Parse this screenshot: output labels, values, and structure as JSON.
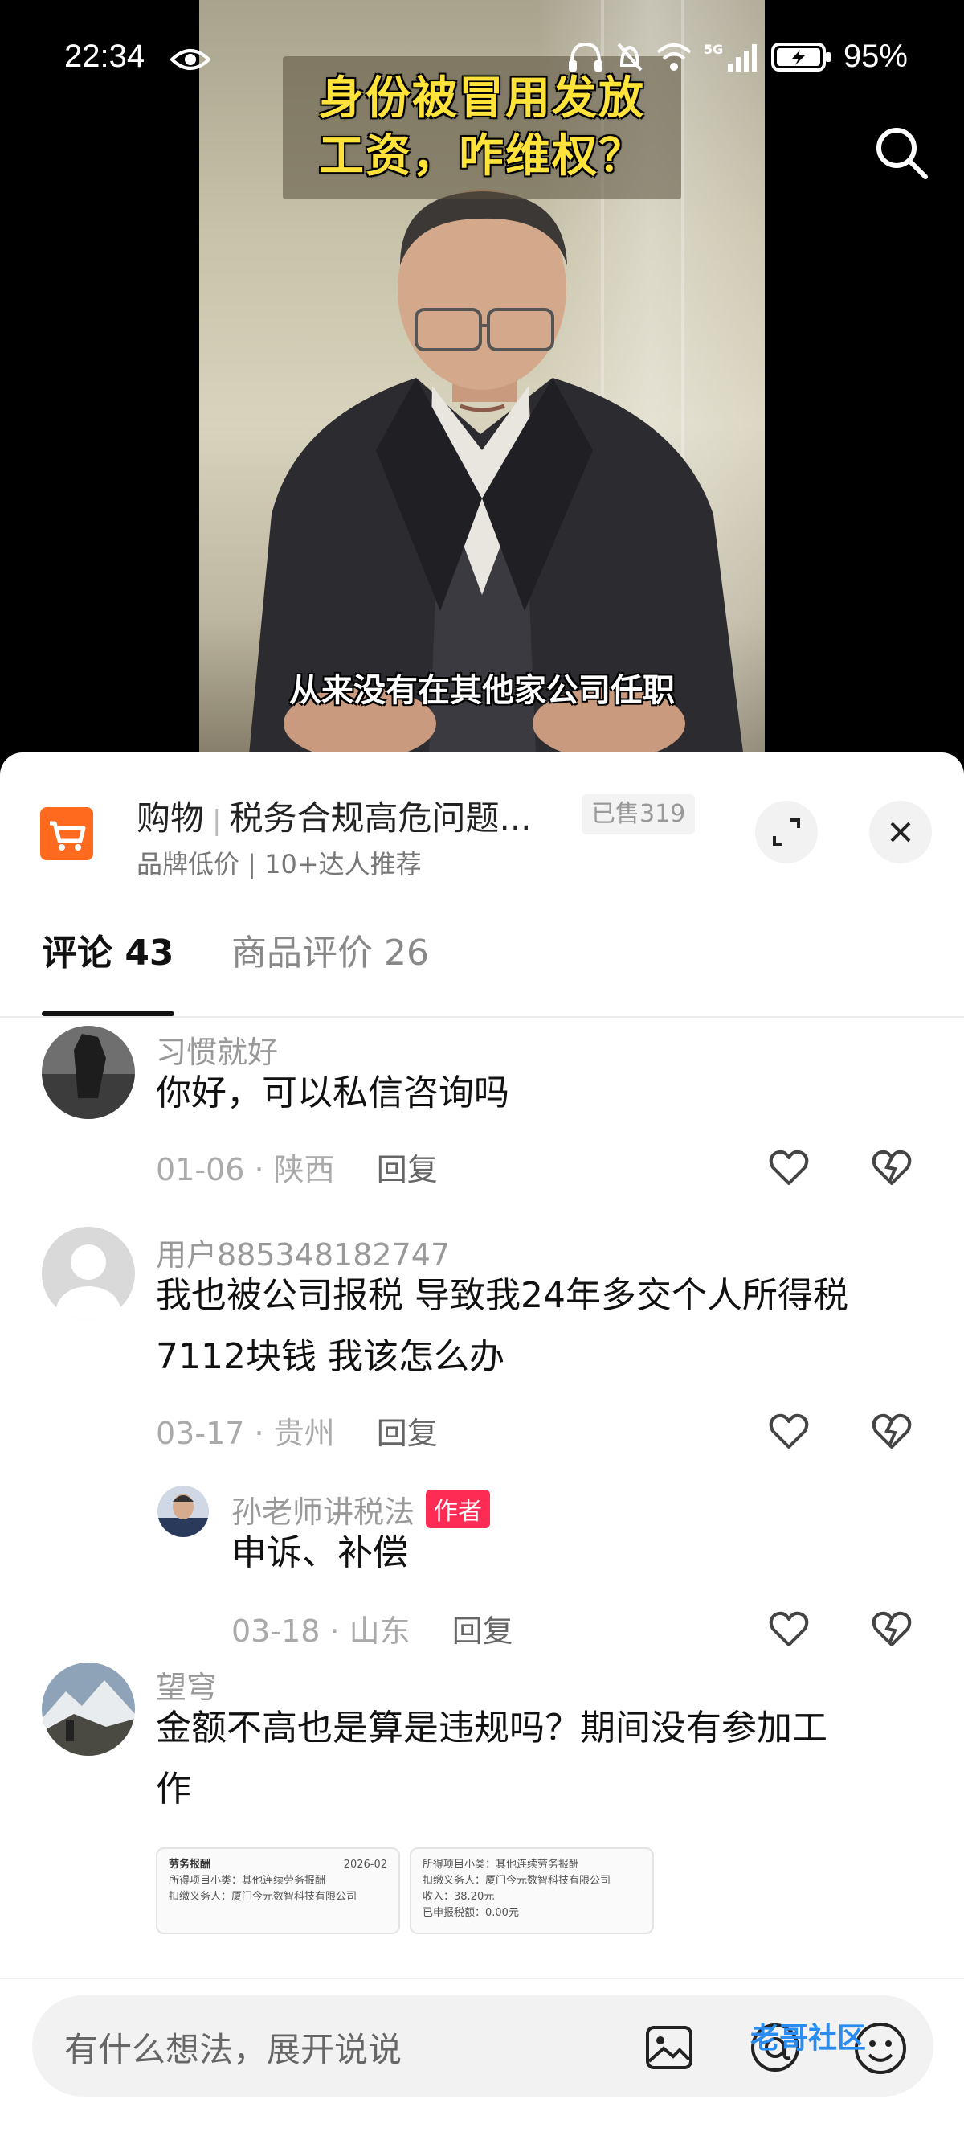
{
  "status_bar": {
    "time": "22:34",
    "battery": "95%",
    "network": "5G"
  },
  "video": {
    "title_line1": "身份被冒用发放",
    "title_line2": "工资，咋维权？",
    "subtitle": "从来没有在其他家公司任职"
  },
  "shop": {
    "tag": "购物",
    "title": "税务合规高危问题...",
    "sold": "已售319",
    "subtitle": "品牌低价 | 10+达人推荐"
  },
  "tabs": [
    {
      "label": "评论 43",
      "active": true
    },
    {
      "label": "商品评价 26",
      "active": false
    }
  ],
  "comments": [
    {
      "name": "习惯就好",
      "text": "你好，可以私信咨询吗",
      "date": "01-06",
      "location": "陕西",
      "reply_label": "回复"
    },
    {
      "name": "用户885348182747",
      "text_line1": "我也被公司报税 导致我24年多交个人所得税",
      "text_line2": "7112块钱  我该怎么办",
      "date": "03-17",
      "location": "贵州",
      "reply_label": "回复",
      "replies": [
        {
          "name": "孙老师讲税法",
          "badge": "作者",
          "text": "申诉、补偿",
          "date": "03-18",
          "location": "山东",
          "reply_label": "回复"
        }
      ]
    },
    {
      "name": "望穹",
      "text_line1": "金额不高也是算是违规吗？期间没有参加工",
      "text_line2": "作",
      "images": [
        {
          "l1": "劳务报酬",
          "l1b": "2026-02",
          "l2": "所得项目小类：其他连续劳务报酬",
          "l3": "扣缴义务人：厦门今元数智科技有限公司"
        },
        {
          "l1": "所得项目小类：其他连续劳务报酬",
          "l2": "扣缴义务人：厦门今元数智科技有限公司",
          "l3": "收入：38.20元",
          "l4": "已申报税额：0.00元"
        }
      ]
    }
  ],
  "input": {
    "placeholder": "有什么想法，展开说说"
  },
  "watermark": "老哥社区",
  "colors": {
    "accent": "#fe2c55",
    "cart": "#ff6a1f",
    "title_yellow": "#ffe23a"
  }
}
